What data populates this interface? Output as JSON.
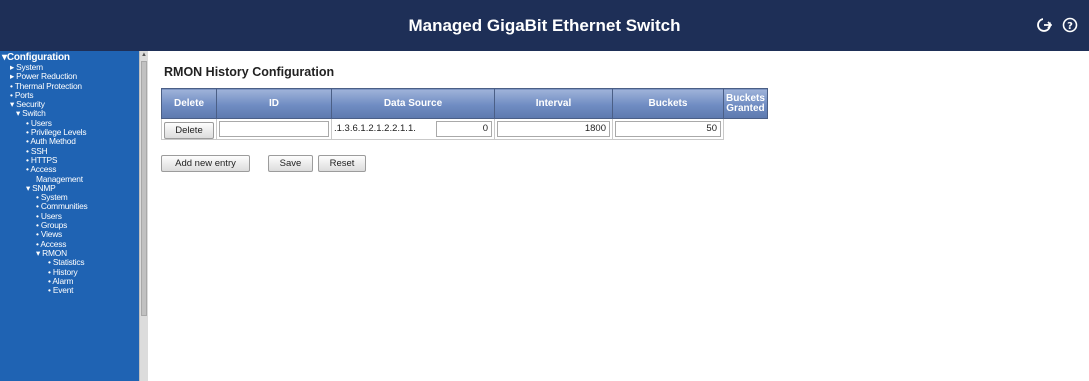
{
  "header": {
    "title": "Managed GigaBit Ethernet Switch"
  },
  "sidebar": {
    "items": [
      {
        "label": "▾Configuration",
        "level": 0
      },
      {
        "label": "▸ System",
        "level": 1
      },
      {
        "label": "▸ Power Reduction",
        "level": 1
      },
      {
        "label": "• Thermal Protection",
        "level": 1
      },
      {
        "label": "• Ports",
        "level": 1
      },
      {
        "label": "▾ Security",
        "level": 1
      },
      {
        "label": "▾ Switch",
        "level": 2
      },
      {
        "label": "• Users",
        "level": 3
      },
      {
        "label": "• Privilege Levels",
        "level": 3
      },
      {
        "label": "• Auth Method",
        "level": 3
      },
      {
        "label": "• SSH",
        "level": 3
      },
      {
        "label": "• HTTPS",
        "level": 3
      },
      {
        "label": "• Access",
        "level": 3
      },
      {
        "label": "Management",
        "level": 4
      },
      {
        "label": "▾ SNMP",
        "level": 3
      },
      {
        "label": "• System",
        "level": 4
      },
      {
        "label": "• Communities",
        "level": 4
      },
      {
        "label": "• Users",
        "level": 4
      },
      {
        "label": "• Groups",
        "level": 4
      },
      {
        "label": "• Views",
        "level": 4
      },
      {
        "label": "• Access",
        "level": 4
      },
      {
        "label": "▾ RMON",
        "level": 4
      },
      {
        "label": "• Statistics",
        "level": 5
      },
      {
        "label": "• History",
        "level": 5
      },
      {
        "label": "• Alarm",
        "level": 5
      },
      {
        "label": "• Event",
        "level": 5
      }
    ]
  },
  "main": {
    "title": "RMON History Configuration",
    "columns": {
      "delete": "Delete",
      "id": "ID",
      "data_source": "Data Source",
      "interval": "Interval",
      "buckets": "Buckets",
      "buckets_granted_1": "Buckets",
      "buckets_granted_2": "Granted"
    },
    "row": {
      "delete_button": "Delete",
      "id_value": "",
      "data_source_prefix": ".1.3.6.1.2.1.2.2.1.1.",
      "data_source_value": "0",
      "interval_value": "1800",
      "buckets_value": "50",
      "buckets_granted_value": ""
    },
    "buttons": {
      "add_new_entry": "Add new entry",
      "save": "Save",
      "reset": "Reset"
    }
  },
  "colors": {
    "header_bg": "#1e2f57",
    "sidebar_bg": "#1f63b3",
    "table_header": "#6f8cc2"
  }
}
